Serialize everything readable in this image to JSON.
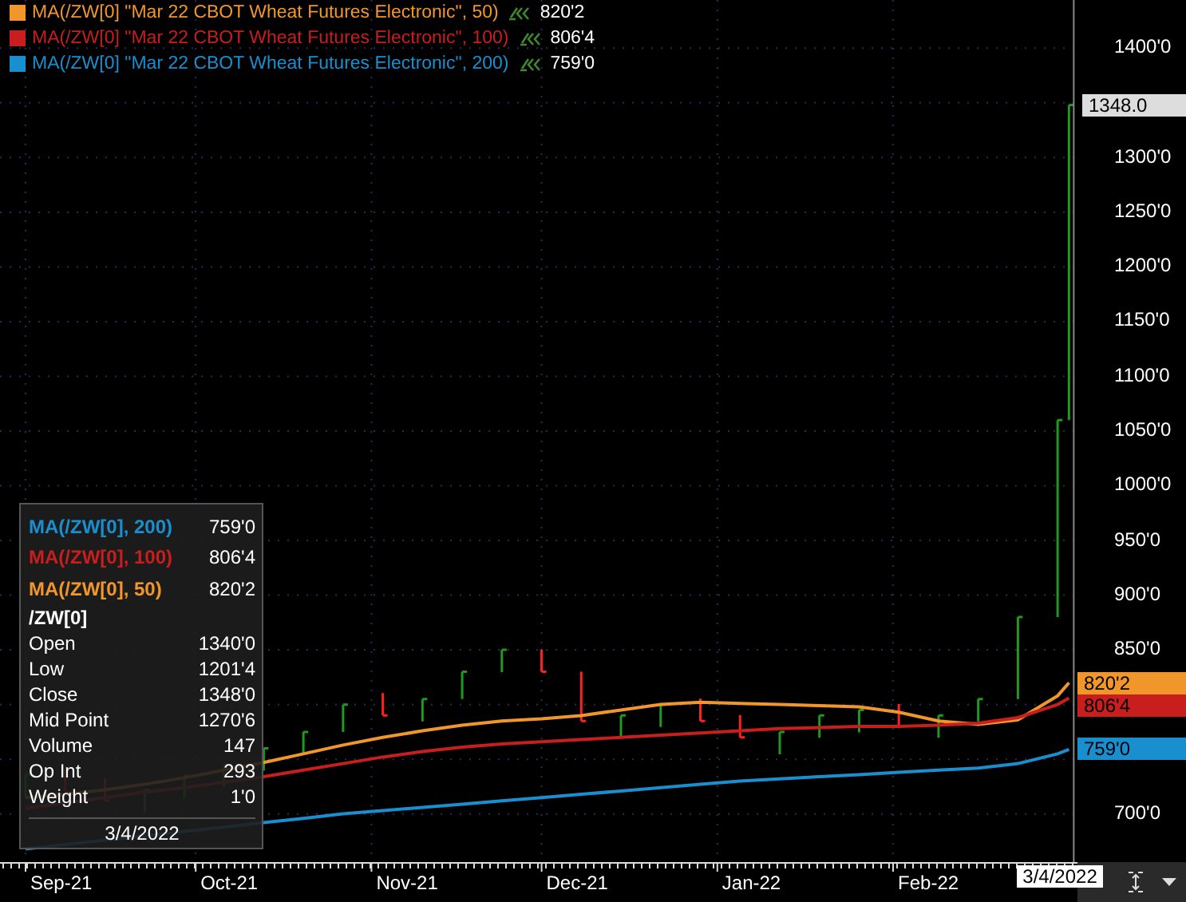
{
  "legend": [
    {
      "label": "MA(/ZW[0] \"Mar 22 CBOT Wheat Futures Electronic\", 50)",
      "value": "820'2",
      "color": "#f0962b"
    },
    {
      "label": "MA(/ZW[0] \"Mar 22 CBOT Wheat Futures Electronic\", 100)",
      "value": "806'4",
      "color": "#c81e1e"
    },
    {
      "label": "MA(/ZW[0] \"Mar 22 CBOT Wheat Futures Electronic\", 200)",
      "value": "759'0",
      "color": "#1a8fd0"
    }
  ],
  "price_axis": [
    {
      "label": "1400'0"
    },
    {
      "label": "1300'0"
    },
    {
      "label": "1250'0"
    },
    {
      "label": "1200'0"
    },
    {
      "label": "1150'0"
    },
    {
      "label": "1100'0"
    },
    {
      "label": "1050'0"
    },
    {
      "label": "1000'0"
    },
    {
      "label": "950'0"
    },
    {
      "label": "900'0"
    },
    {
      "label": "850'0"
    },
    {
      "label": "700'0"
    }
  ],
  "time_axis": [
    {
      "label": "Sep-21"
    },
    {
      "label": "Oct-21"
    },
    {
      "label": "Nov-21"
    },
    {
      "label": "Dec-21"
    },
    {
      "label": "Jan-22"
    },
    {
      "label": "Feb-22"
    }
  ],
  "price_markers": [
    {
      "label": "1348.0"
    },
    {
      "label": "820'2",
      "color": "#f0962b"
    },
    {
      "label": "806'4",
      "color": "#c81e1e"
    },
    {
      "label": "759'0",
      "color": "#1a8fd0"
    }
  ],
  "tooltip": {
    "studies": [
      {
        "label": "MA(/ZW[0], 200)",
        "value": "759'0",
        "color": "#1a8fd0"
      },
      {
        "label": "MA(/ZW[0], 100)",
        "value": "806'4",
        "color": "#c81e1e"
      },
      {
        "label": "MA(/ZW[0], 50)",
        "value": "820'2",
        "color": "#f0962b"
      }
    ],
    "symbol": "/ZW[0]",
    "fields": [
      {
        "label": "Open",
        "value": "1340'0"
      },
      {
        "label": "Low",
        "value": "1201'4"
      },
      {
        "label": "Close",
        "value": "1348'0"
      },
      {
        "label": "Mid Point",
        "value": "1270'6"
      },
      {
        "label": "Volume",
        "value": "147"
      },
      {
        "label": "Op Int",
        "value": "293"
      },
      {
        "label": "Weight",
        "value": "1'0"
      }
    ],
    "date": "3/4/2022"
  },
  "cursor_date": "3/4/2022"
}
